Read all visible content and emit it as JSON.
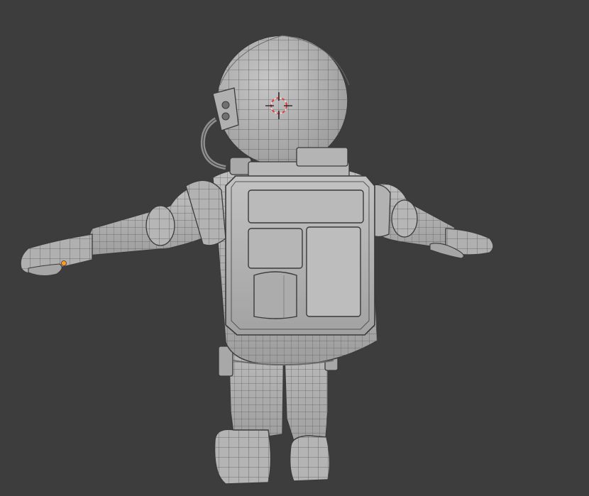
{
  "viewport": {
    "background_color": "#3d3d3d",
    "object_color": "#bdbdbd",
    "wire_color": "#5a5a5a",
    "edge_dark": "#3a3a3a",
    "cursor_primary": "#e63c3c",
    "cursor_secondary": "#ffffff",
    "origin_color": "#ff9a1e"
  },
  "scene": {
    "object_icon": "astronaut-mesh",
    "cursor_icon": "3d-cursor-icon",
    "origin_icon": "object-origin-dot"
  }
}
